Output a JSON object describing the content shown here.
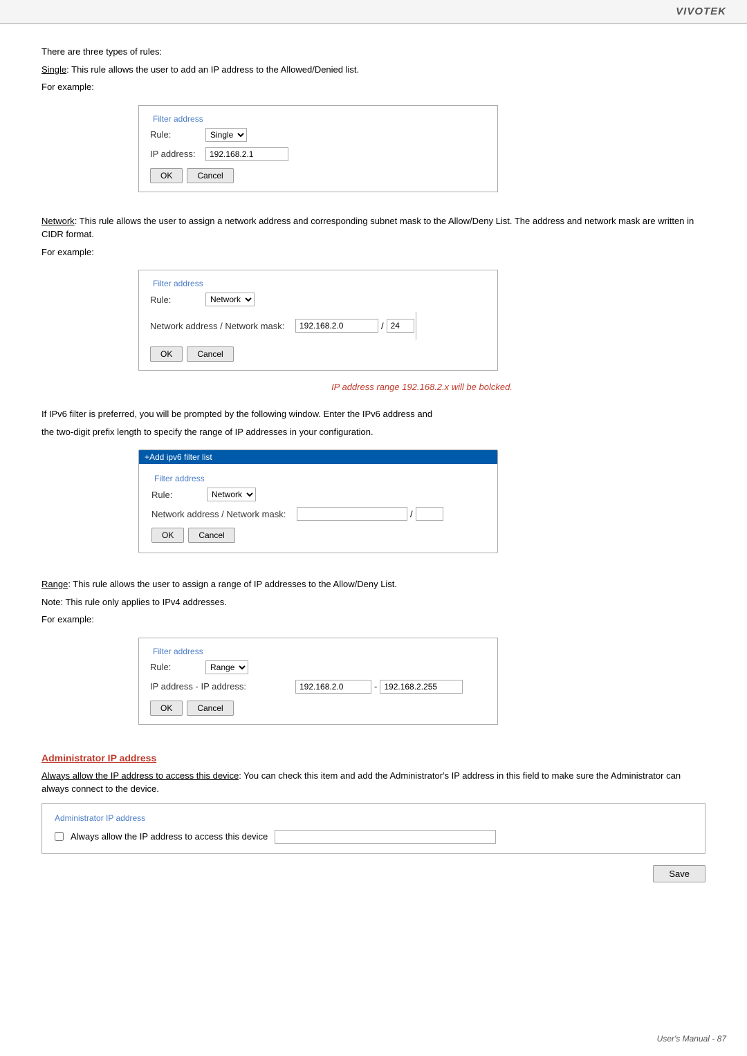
{
  "brand": "VIVOTEK",
  "footer": "User's Manual - 87",
  "intro": {
    "line1": "There are three types of rules:",
    "single_term": "Single",
    "single_desc": ": This rule allows the user to add an IP address to the Allowed/Denied list.",
    "for_example": "For example:"
  },
  "filter_address_1": {
    "legend": "Filter address",
    "rule_label": "Rule:",
    "rule_value": "Single",
    "ip_label": "IP address:",
    "ip_value": "192.168.2.1",
    "ok_label": "OK",
    "cancel_label": "Cancel"
  },
  "network_section": {
    "term": "Network",
    "desc": ": This rule allows the user to assign a network address and corresponding subnet mask to the Allow/Deny List. The address and network mask are written in CIDR format.",
    "for_example": "For example:",
    "legend": "Filter address",
    "rule_label": "Rule:",
    "rule_value": "Network",
    "net_label": "Network address / Network mask:",
    "net_value": "192.168.2.0",
    "mask_value": "24",
    "ok_label": "OK",
    "cancel_label": "Cancel",
    "ip_range_note": "IP address range 192.168.2.x will be bolcked."
  },
  "ipv6_section": {
    "intro_line1": "If IPv6 filter is preferred, you will be prompted by the following window. Enter the IPv6 address and",
    "intro_line2": "the two-digit prefix length to specify the range of IP addresses in your configuration.",
    "dialog_title": "+Add ipv6 filter list",
    "legend": "Filter address",
    "rule_label": "Rule:",
    "rule_value": "Network",
    "net_label": "Network address / Network mask:",
    "ok_label": "OK",
    "cancel_label": "Cancel"
  },
  "range_section": {
    "term": "Range",
    "desc": ": This rule allows the user to assign a range of IP addresses to the Allow/Deny List.",
    "note1": "Note: This rule only applies to IPv4 addresses.",
    "for_example": "For example:",
    "legend": "Filter address",
    "rule_label": "Rule:",
    "rule_value": "Range",
    "ip_range_label": "IP address - IP address:",
    "ip_from": "192.168.2.0",
    "ip_to": "192.168.2.255",
    "ok_label": "OK",
    "cancel_label": "Cancel"
  },
  "admin_section": {
    "heading": "Administrator IP address",
    "always_term": "Always allow the IP address to access this device",
    "always_desc": ": You can check this item and add the Administrator's IP address in this field to make sure the Administrator can always connect to the device.",
    "legend": "Administrator IP address",
    "checkbox_label": "Always allow the IP address to access this device",
    "save_label": "Save"
  }
}
